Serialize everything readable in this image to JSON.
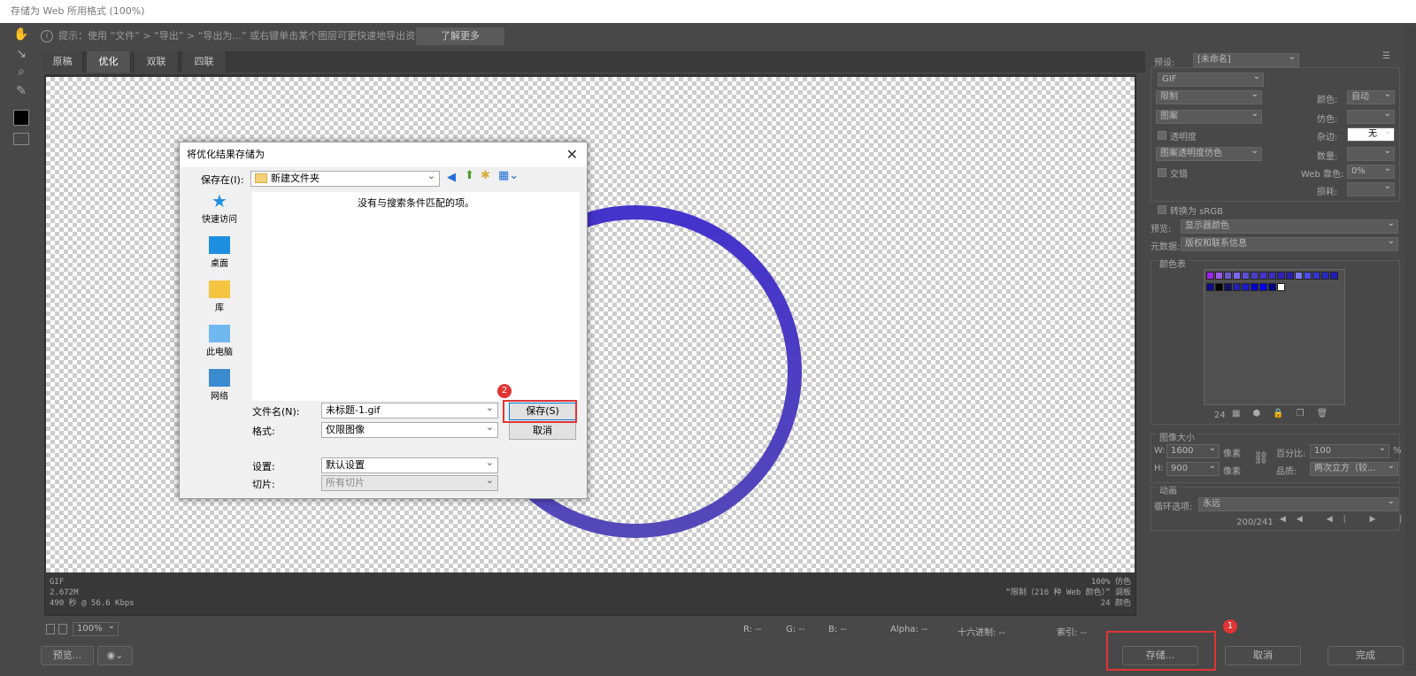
{
  "window": {
    "title": "存储为 Web 所用格式 (100%)"
  },
  "tip": {
    "icon": "info-icon",
    "text": "提示：使用 “文件” > “导出” > “导出为...” 或右键单击某个图层可更快速地导出资源",
    "learn_more": "了解更多"
  },
  "tabs": [
    "原稿",
    "优化",
    "双联",
    "四联"
  ],
  "tools": [
    "hand-icon",
    "slice-select-icon",
    "zoom-icon",
    "eyedropper-icon"
  ],
  "canvas_info": {
    "left": [
      "GIF",
      "2.672M",
      "490 秒 @ 56.6 Kbps"
    ],
    "right": [
      "100% 仿色",
      "“限制（216 种 Web 颜色）” 调板",
      "24 颜色"
    ]
  },
  "statusbar": {
    "zoom": "100%",
    "r": "R: --",
    "g": "G: --",
    "b": "B: --",
    "alpha": "Alpha: --",
    "hex": "十六进制: --",
    "index": "索引: --"
  },
  "bottom": {
    "preview": "预览...",
    "save": "存储...",
    "cancel": "取消",
    "done": "完成",
    "badge1": "1"
  },
  "panel": {
    "preset_label": "预设:",
    "preset_value": "[未命名]",
    "format": "GIF",
    "reduction": "限制",
    "colors_label": "颜色:",
    "colors_value": "自动",
    "dither": "图案",
    "dither_label": "仿色:",
    "transparency": "透明度",
    "matte_label": "杂边:",
    "matte_value": "无",
    "trans_dither": "图案透明度仿色",
    "amount_label": "数量:",
    "interlaced": "交错",
    "websnap_label": "Web 靠色:",
    "websnap_value": "0%",
    "lossy_label": "损耗:",
    "srgb": "转换为 sRGB",
    "preview_label": "预览:",
    "preview_value": "显示器颜色",
    "metadata_label": "元数据:",
    "metadata_value": "版权和联系信息",
    "colortable_label": "颜色表",
    "color_count": "24",
    "swatches": [
      "#a020f0",
      "#9b59e8",
      "#6a5acd",
      "#7b68ee",
      "#5b4fd6",
      "#4b3fc9",
      "#4433cc",
      "#3a2fc0",
      "#3322bb",
      "#2a1fb0",
      "#7a7af0",
      "#4a4ae8",
      "#3535d0",
      "#2828c4",
      "#1e1eb8",
      "#0d0d90",
      "#000000",
      "#111166",
      "#2222aa",
      "#1a1ad0",
      "#0000cc",
      "#0000ff",
      "#000088",
      "#ffffff"
    ],
    "imagesize_label": "图像大小",
    "w_label": "W:",
    "w_value": "1600",
    "h_label": "H:",
    "h_value": "900",
    "px_label": "像素",
    "percent_label": "百分比:",
    "percent_value": "100",
    "pct_unit": "%",
    "quality_label": "品质:",
    "quality_value": "两次立方（较...",
    "anim_label": "动画",
    "loop_label": "循环选项:",
    "loop_value": "永远",
    "frame_counter": "200/241"
  },
  "dialog": {
    "title": "将优化结果存储为",
    "save_in_label": "保存在(I):",
    "folder": "新建文件夹",
    "empty_msg": "没有与搜索条件匹配的项。",
    "places": [
      "快速访问",
      "桌面",
      "库",
      "此电脑",
      "网络"
    ],
    "filename_label": "文件名(N):",
    "filename": "未标题-1.gif",
    "format_label": "格式:",
    "format_value": "仅限图像",
    "settings_label": "设置:",
    "settings_value": "默认设置",
    "slices_label": "切片:",
    "slices_value": "所有切片",
    "save_btn": "保存(S)",
    "cancel_btn": "取消",
    "badge2": "2"
  },
  "colors": {
    "ring_top": "#4433cc",
    "ring_bottom": "#5548b8",
    "highlight": "#e23434"
  }
}
